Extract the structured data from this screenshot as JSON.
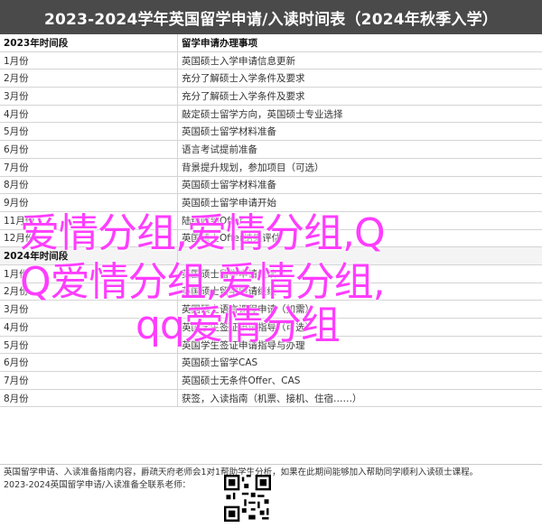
{
  "banner": {
    "title": "2023-2024学年英国留学申请/入读时间表（2024年秋季入学）"
  },
  "table": {
    "header": [
      "2023年时间段",
      "留学申请办理事项"
    ],
    "rows": [
      [
        "1月份",
        "英国硕士入学申请信息更新"
      ],
      [
        "2月份",
        "充分了解硕士入学条件及要求"
      ],
      [
        "3月份",
        "充分了解硕士入学条件及要求"
      ],
      [
        "4月份",
        "敲定硕士留学方向，英国硕士专业选择"
      ],
      [
        "5月份",
        "英国硕士留学材料准备"
      ],
      [
        "6月份",
        "语言考试提前准备"
      ],
      [
        "7月份",
        "背景提升规划，参加项目（可选）"
      ],
      [
        "8月份",
        "英国硕士留学材料准备"
      ],
      [
        "9月份",
        "英国硕士留学申请开始"
      ],
      [
        "11月份",
        "陆续收到Offer"
      ],
      [
        "12月份",
        "英国硕士Offer结果评估"
      ]
    ],
    "section": "2024年时间段",
    "rows2": [
      [
        "1月份",
        "英国硕士留学申请继续"
      ],
      [
        "2月份",
        "英国硕士留学申请继续"
      ],
      [
        "3月份",
        "英国硕士语言课程申请（如需）"
      ],
      [
        "4月份",
        "英国学生签证申请指导（可选）"
      ],
      [
        "5月份",
        "英国学生签证申请指导与办理"
      ],
      [
        "6月份",
        "英国硕士留学CAS"
      ],
      [
        "7月份",
        "英国硕士无条件Offer、CAS"
      ],
      [
        "8月份",
        "获签，入读指南（机票、接机、住宿……）"
      ]
    ]
  },
  "overlay": {
    "line1": "爱情分组,爱情分组,Q",
    "line2": "Q爱情分组,爱情分组,",
    "line3": "qq爱情分组"
  },
  "footer": {
    "line1": "英国留学申请、入读准备指南内容，爵疏天府老师会1对1帮助学生分析，如果在此期间能够加入帮助同学顺利入读硕士课程。",
    "line2": "2023-2024英国留学申请/入读准备全联系老师："
  }
}
